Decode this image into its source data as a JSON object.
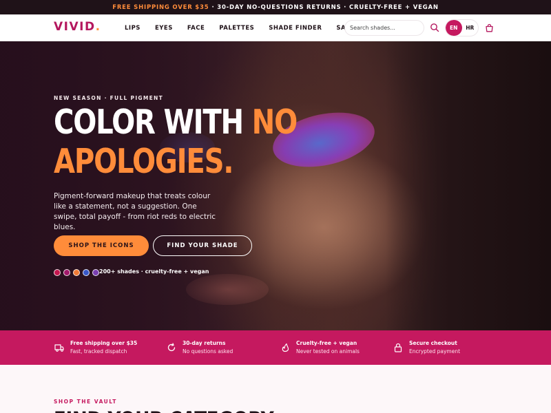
{
  "announcement": {
    "accent": "FREE SHIPPING OVER $35",
    "rest": "· 30-DAY NO-QUESTIONS RETURNS · CRUELTY-FREE + VEGAN"
  },
  "header": {
    "logo": "VIVID",
    "logo_dot": ".",
    "nav": [
      "LIPS",
      "EYES",
      "FACE",
      "PALETTES",
      "SHADE FINDER",
      "SALE"
    ],
    "search_placeholder": "Search shades...",
    "lang": {
      "en": "EN",
      "hr": "HR",
      "active": "EN"
    },
    "icons": {
      "search": "search-icon",
      "cart": "bag-icon"
    }
  },
  "hero": {
    "eyebrow": "NEW SEASON · FULL PIGMENT",
    "headline_white_1": "COLOR WITH ",
    "headline_accent_1": "NO",
    "headline_accent_2": "APOLOGIES.",
    "subtext": "Pigment-forward makeup that treats colour like a statement, not a suggestion. One swipe, total payoff - from riot reds to electric blues.",
    "primary_cta": "SHOP THE ICONS",
    "secondary_cta": "FIND YOUR SHADE",
    "swatch_colors": [
      "#c4174f",
      "#a0196a",
      "#ee7a36",
      "#3858c8",
      "#7a3fb0"
    ],
    "shades_text": "200+ shades · cruelty-free + vegan"
  },
  "features": [
    {
      "icon": "truck-icon",
      "title": "Free shipping over $35",
      "desc": "Fast, tracked dispatch"
    },
    {
      "icon": "refresh-icon",
      "title": "30-day returns",
      "desc": "No questions asked"
    },
    {
      "icon": "leaf-icon",
      "title": "Cruelty-free + vegan",
      "desc": "Never tested on animals"
    },
    {
      "icon": "lock-icon",
      "title": "Secure checkout",
      "desc": "Encrypted payment"
    }
  ],
  "section": {
    "kicker": "SHOP THE VAULT",
    "title": "FIND YOUR CATEGORY"
  },
  "colors": {
    "brand": "#c5195f",
    "accent": "#ff8c3a",
    "dark": "#1f1218"
  }
}
